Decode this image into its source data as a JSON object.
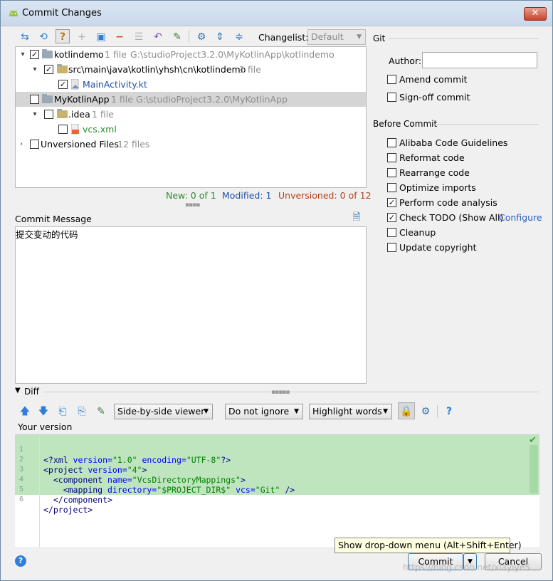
{
  "window": {
    "title": "Commit Changes",
    "close_glyph": "✕"
  },
  "toolbar": {
    "changelist_label": "Changelist:",
    "changelist_value": "Default",
    "icons": [
      "diff-arrows-icon",
      "refresh-icon",
      "unversioned-icon",
      "add-icon",
      "move-icon",
      "remove-icon",
      "group-icon",
      "rollback-icon",
      "edit-source-icon",
      "settings-icon",
      "expand-all-icon",
      "collapse-all-icon"
    ]
  },
  "tree": {
    "rows": [
      {
        "name": "kotlindemo",
        "count": "1 file",
        "path": "G:\\studioProject3.2.0\\MyKotlinApp\\kotlindemo",
        "checked": true
      },
      {
        "name": "src\\main\\java\\kotlin\\yhsh\\cn\\kotlindemo",
        "count": "1 file",
        "checked": true
      },
      {
        "name": "MainActivity.kt",
        "checked": true
      },
      {
        "name": "MyKotlinApp",
        "count": "1 file",
        "path": "G:\\studioProject3.2.0\\MyKotlinApp",
        "checked": false
      },
      {
        "name": ".idea",
        "count": "1 file",
        "checked": false
      },
      {
        "name": "vcs.xml",
        "checked": false
      },
      {
        "name": "Unversioned Files",
        "count": "12 files",
        "checked": false
      }
    ]
  },
  "stats": {
    "new": "New: 0 of 1",
    "modified": "Modified: 1",
    "unversioned": "Unversioned: 0 of 12",
    "new_color": "#2e8b2e",
    "modified_color": "#1f4fa8",
    "unversioned_color": "#b8401a"
  },
  "commit_message": {
    "label": "Commit Message",
    "text": "提交变动的代码"
  },
  "git": {
    "title": "Git",
    "author_label": "Author:",
    "author_value": "",
    "amend_label": "Amend commit",
    "signoff_label": "Sign-off commit"
  },
  "before_commit": {
    "title": "Before Commit",
    "options": [
      {
        "label": "Alibaba Code Guidelines",
        "checked": false
      },
      {
        "label": "Reformat code",
        "checked": false
      },
      {
        "label": "Rearrange code",
        "checked": false
      },
      {
        "label": "Optimize imports",
        "checked": false
      },
      {
        "label": "Perform code analysis",
        "checked": true
      },
      {
        "label": "Check TODO (Show All)",
        "checked": true
      },
      {
        "label": "Cleanup",
        "checked": false
      },
      {
        "label": "Update copyright",
        "checked": false
      }
    ],
    "configure_link": "Configure"
  },
  "diff": {
    "title": "Diff",
    "viewer": "Side-by-side viewer",
    "ignore": "Do not ignore",
    "highlight": "Highlight words",
    "help_glyph": "?",
    "version_label": "Your version",
    "lines": [
      "1",
      "2",
      "3",
      "4",
      "5",
      "6"
    ]
  },
  "footer": {
    "commit_label": "Commit",
    "cancel_label": "Cancel",
    "tooltip": "Show drop-down menu (Alt+Shift+Enter)",
    "help_glyph": "?",
    "watermark": "https://blog.csdn.net/xiayiye5"
  },
  "colors": {
    "accent": "#2f7fd8",
    "selection": "#d5d5d5",
    "diff_added": "#bfe5bf"
  }
}
